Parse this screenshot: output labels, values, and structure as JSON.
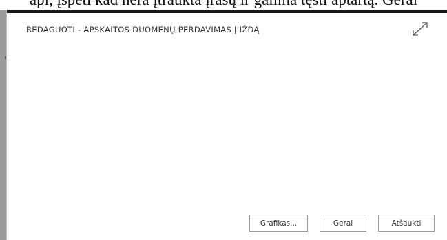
{
  "host_page": {
    "clipped_text": "api, įspėti kad nėra įtraukta įrašų ir galima tęsti aptartą. Gerai"
  },
  "dialog": {
    "title": "REDAGUOTI - APSKAITOS DUOMENŲ PERDAVIMAS Į IŽDĄ",
    "expand_icon": "expand-diagonal-arrows"
  },
  "footer": {
    "graph_label": "Grafikas...",
    "ok_label": "Gerai",
    "cancel_label": "Atšaukti"
  },
  "colors": {
    "title_text": "#333333",
    "button_border": "#9a9a9a",
    "page_background": "#ffffff"
  }
}
